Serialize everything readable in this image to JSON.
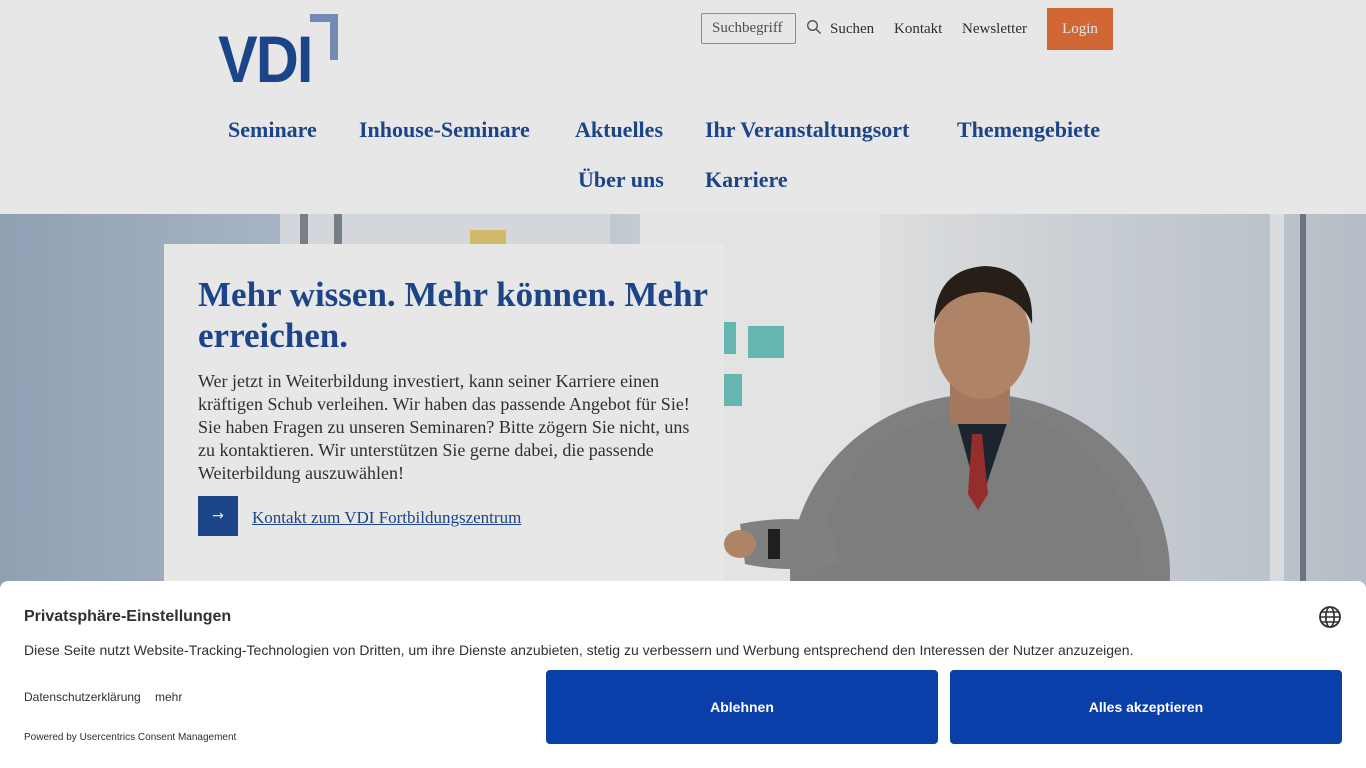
{
  "brand": {
    "logo_text": "VDI",
    "primary": "#1e4a97",
    "accent": "#e8713a",
    "logo_corner": "#7f98c4"
  },
  "header": {
    "search_placeholder": "Suchbegriff eingeben",
    "search_label": "Suchen",
    "links": [
      "Kontakt",
      "Newsletter"
    ],
    "login_label": "Login",
    "search_icon": "search-icon"
  },
  "nav": {
    "items": [
      "Seminare",
      "Inhouse-Seminare",
      "Aktuelles",
      "Ihr Veranstaltungsort",
      "Themengebiete",
      "Über uns",
      "Karriere"
    ]
  },
  "hero": {
    "title": "Mehr wissen. Mehr können. Mehr erreichen.",
    "text": "Wer jetzt in Weiterbildung investiert, kann seiner Karriere einen kräftigen Schub verleihen. Wir haben das passende Angebot für Sie! Sie haben Fragen zu unseren Seminaren? Bitte zögern Sie nicht, uns zu kontaktieren. Wir unterstützen Sie gerne dabei, die passende Weiterbildung auszuwählen!",
    "arrow": "→",
    "arrow_icon": "arrow-right-icon",
    "contact_link": "Kontakt zum VDI Fortbildungszentrum"
  },
  "consent": {
    "title": "Privatsphäre-Einstellungen",
    "description": "Diese Seite nutzt Website-Tracking-Technologien von Dritten, um ihre Dienste anzubieten, stetig zu verbessern und Werbung entsprechend den Interessen der Nutzer anzuzeigen.",
    "privacy_link": "Datenschutzerklärung",
    "more_link": "mehr",
    "powered_by": "Powered by Usercentrics Consent Management",
    "deny_label": "Ablehnen",
    "accept_label": "Alles akzeptieren",
    "button_color": "#0a3ea8",
    "language_icon": "globe-icon"
  }
}
